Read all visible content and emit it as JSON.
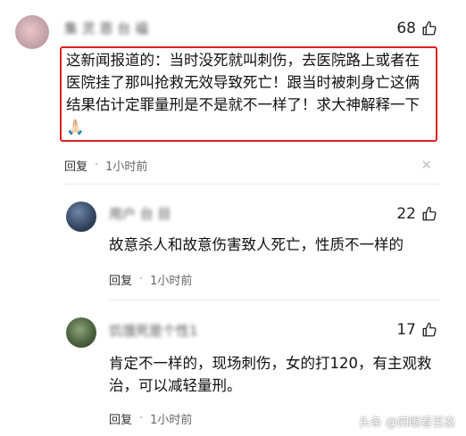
{
  "comments": [
    {
      "username": "集 灵 恩 台 福",
      "likes": "68",
      "text": "这新闻报道的：当时没死就叫刺伤，去医院路上或者在医院挂了那叫抢救无效导致死亡！跟当时被刺身亡这俩结果估计定罪量刑是不是就不一样了！求大神解释一下🙏🏻",
      "reply_label": "回复",
      "time": "1小时前"
    },
    {
      "username": "用户 台 目",
      "likes": "22",
      "text": "故意杀人和故意伤害致人死亡，性质不一样的",
      "reply_label": "回复",
      "time": "1小时前"
    },
    {
      "username": "饥饿死是个性1",
      "likes": "17",
      "text": "肯定不一样的，现场刺伤，女的打120，有主观救治，可以减轻量刑。",
      "reply_label": "回复",
      "time": "1小时前"
    }
  ],
  "dismiss_glyph": "✕",
  "dot_glyph": "·",
  "watermark": "头条 @四眼看百态",
  "colors": {
    "highlight": "#e02020",
    "background": "#ffffff"
  }
}
